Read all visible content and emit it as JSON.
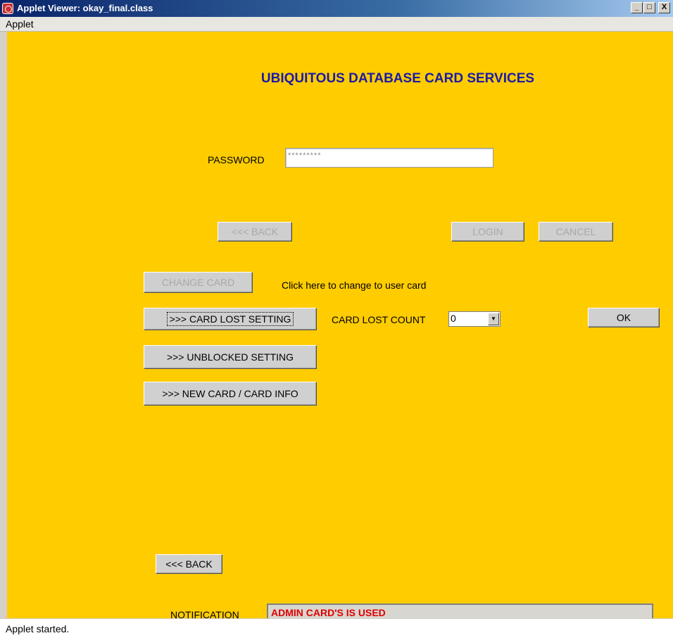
{
  "window": {
    "title": "Applet Viewer: okay_final.class",
    "minimize_label": "_",
    "maximize_label": "□",
    "close_label": "X"
  },
  "menu": {
    "items": [
      "Applet"
    ]
  },
  "applet": {
    "heading": "UBIQUITOUS DATABASE CARD SERVICES",
    "password_label": "PASSWORD",
    "password_value": "*********",
    "back_top_label": "<<< BACK",
    "login_label": "LOGIN",
    "cancel_label": "CANCEL",
    "change_card_label": "CHANGE CARD",
    "change_card_hint": "Click here to change to user card",
    "card_lost_setting_label": ">>> CARD LOST SETTING",
    "card_lost_count_label": "CARD LOST COUNT",
    "card_lost_count_value": "0",
    "ok_label": "OK",
    "unblocked_setting_label": ">>> UNBLOCKED SETTING",
    "new_card_label": ">>> NEW CARD / CARD INFO",
    "back_bottom_label": "<<< BACK",
    "notification_label": "NOTIFICATION",
    "notification_value": "ADMIN CARD'S IS USED"
  },
  "status": {
    "text": "Applet started."
  }
}
